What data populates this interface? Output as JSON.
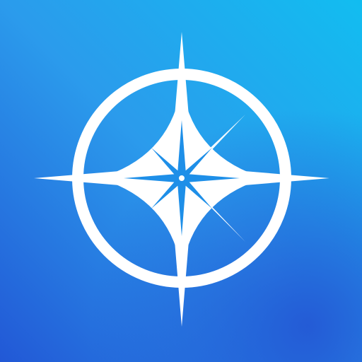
{
  "icon": {
    "name": "compass-rose-icon",
    "colors": {
      "gradient_light": "#12BDF0",
      "gradient_mid": "#2B9BEC",
      "gradient_dark": "#2258D6",
      "glyph": "#FFFFFF",
      "center": "#1E8FE8"
    }
  }
}
